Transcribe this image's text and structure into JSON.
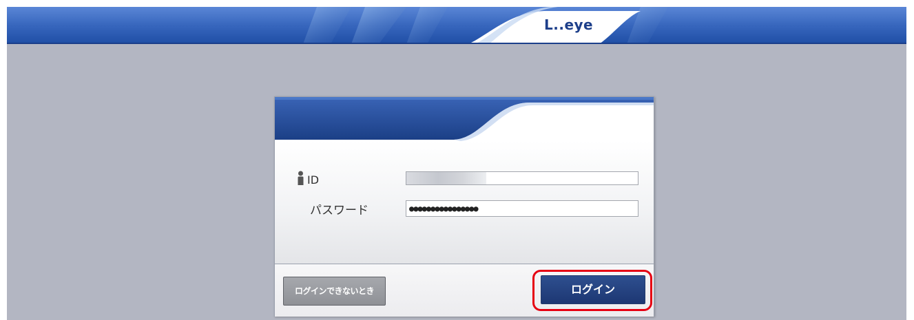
{
  "header": {
    "logo_text": "L..eye"
  },
  "login_form": {
    "id_label": "ID",
    "id_value": "",
    "password_label": "パスワード",
    "password_value": "●●●●●●●●●●●●●●●●"
  },
  "footer": {
    "help_button_label": "ログインできないとき",
    "login_button_label": "ログイン"
  },
  "colors": {
    "page_background": "#b3b6c2",
    "header_blue": "#2b4fa0",
    "dialog_header_blue": "#1e4690",
    "login_button": "#1d3773",
    "help_button": "#9a9ca1",
    "highlight": "#e60012"
  },
  "icons": {
    "id_icon": "person-icon"
  }
}
